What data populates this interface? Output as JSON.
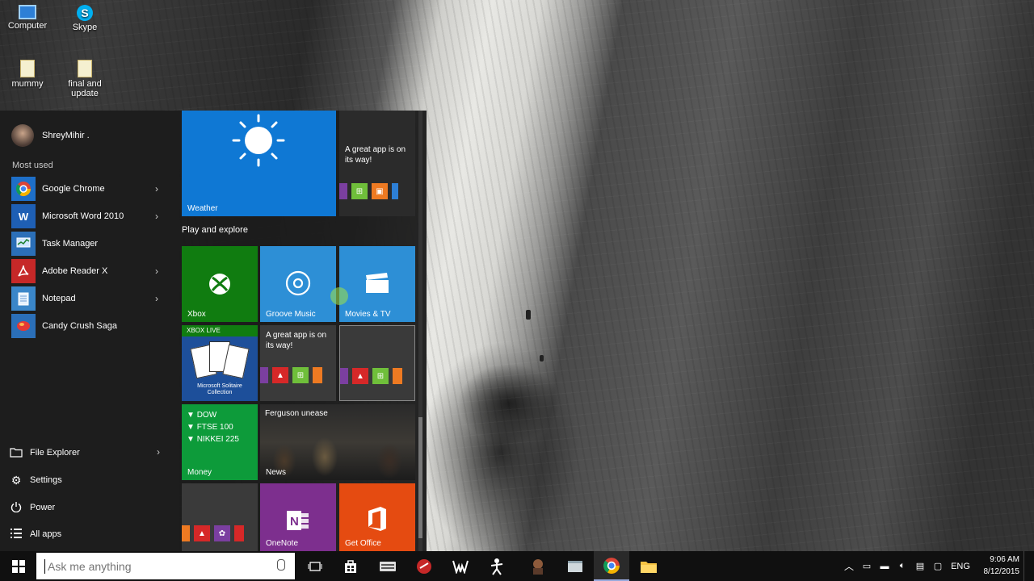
{
  "desktop": {
    "icons": [
      {
        "label": "Computer",
        "icon": "computer-icon"
      },
      {
        "label": "Skype",
        "icon": "skype-icon"
      },
      {
        "label": "mummy",
        "icon": "file-icon"
      },
      {
        "label": "final and update",
        "icon": "file-icon"
      }
    ]
  },
  "start_menu": {
    "user_name": "ShreyMihir .",
    "most_used_label": "Most used",
    "most_used": [
      {
        "label": "Google Chrome",
        "icon": "chrome-icon",
        "color": "#1e6fc8",
        "has_submenu": true
      },
      {
        "label": "Microsoft Word 2010",
        "icon": "word-icon",
        "color": "#1e5fb4",
        "has_submenu": true
      },
      {
        "label": "Task Manager",
        "icon": "task-manager-icon",
        "color": "#2b6fb8",
        "has_submenu": false
      },
      {
        "label": "Adobe Reader X",
        "icon": "adobe-reader-icon",
        "color": "#c62828",
        "has_submenu": true
      },
      {
        "label": "Notepad",
        "icon": "notepad-icon",
        "color": "#3a86c9",
        "has_submenu": true
      },
      {
        "label": "Candy Crush Saga",
        "icon": "candy-crush-icon",
        "color": "#2b6fb8",
        "has_submenu": false
      }
    ],
    "bottom": [
      {
        "label": "File Explorer",
        "icon": "folder-icon",
        "has_submenu": true
      },
      {
        "label": "Settings",
        "icon": "gear-icon",
        "has_submenu": false
      },
      {
        "label": "Power",
        "icon": "power-icon",
        "has_submenu": false
      },
      {
        "label": "All apps",
        "icon": "list-icon",
        "has_submenu": false
      }
    ],
    "chevron": "›",
    "group_label": "Play and explore",
    "tiles": {
      "weather": {
        "label": "Weather",
        "color": "#0f78d4"
      },
      "store_promo": {
        "text": "A great app is on its way!"
      },
      "xbox": {
        "label": "Xbox",
        "color": "#107c10"
      },
      "groove": {
        "label": "Groove Music",
        "color": "#2d8fd6"
      },
      "movies": {
        "label": "Movies & TV",
        "color": "#2d8fd6"
      },
      "solitaire": {
        "badge": "XBOX LIVE",
        "caption": "Microsoft Solitaire Collection"
      },
      "promo2": {
        "text": "A great app is on its way!"
      },
      "money": {
        "label": "Money",
        "color": "#0d9b3a",
        "tickers": [
          "DOW",
          "FTSE 100",
          "NIKKEI 225"
        ]
      },
      "news": {
        "label": "News",
        "headline": "Ferguson unease"
      },
      "onenote": {
        "label": "OneNote",
        "color": "#7d2f8e"
      },
      "office": {
        "label": "Get Office",
        "color": "#e54b11"
      }
    }
  },
  "taskbar": {
    "search_placeholder": "Ask me anything",
    "language": "ENG",
    "time": "9:06 AM",
    "date": "8/12/2015"
  }
}
